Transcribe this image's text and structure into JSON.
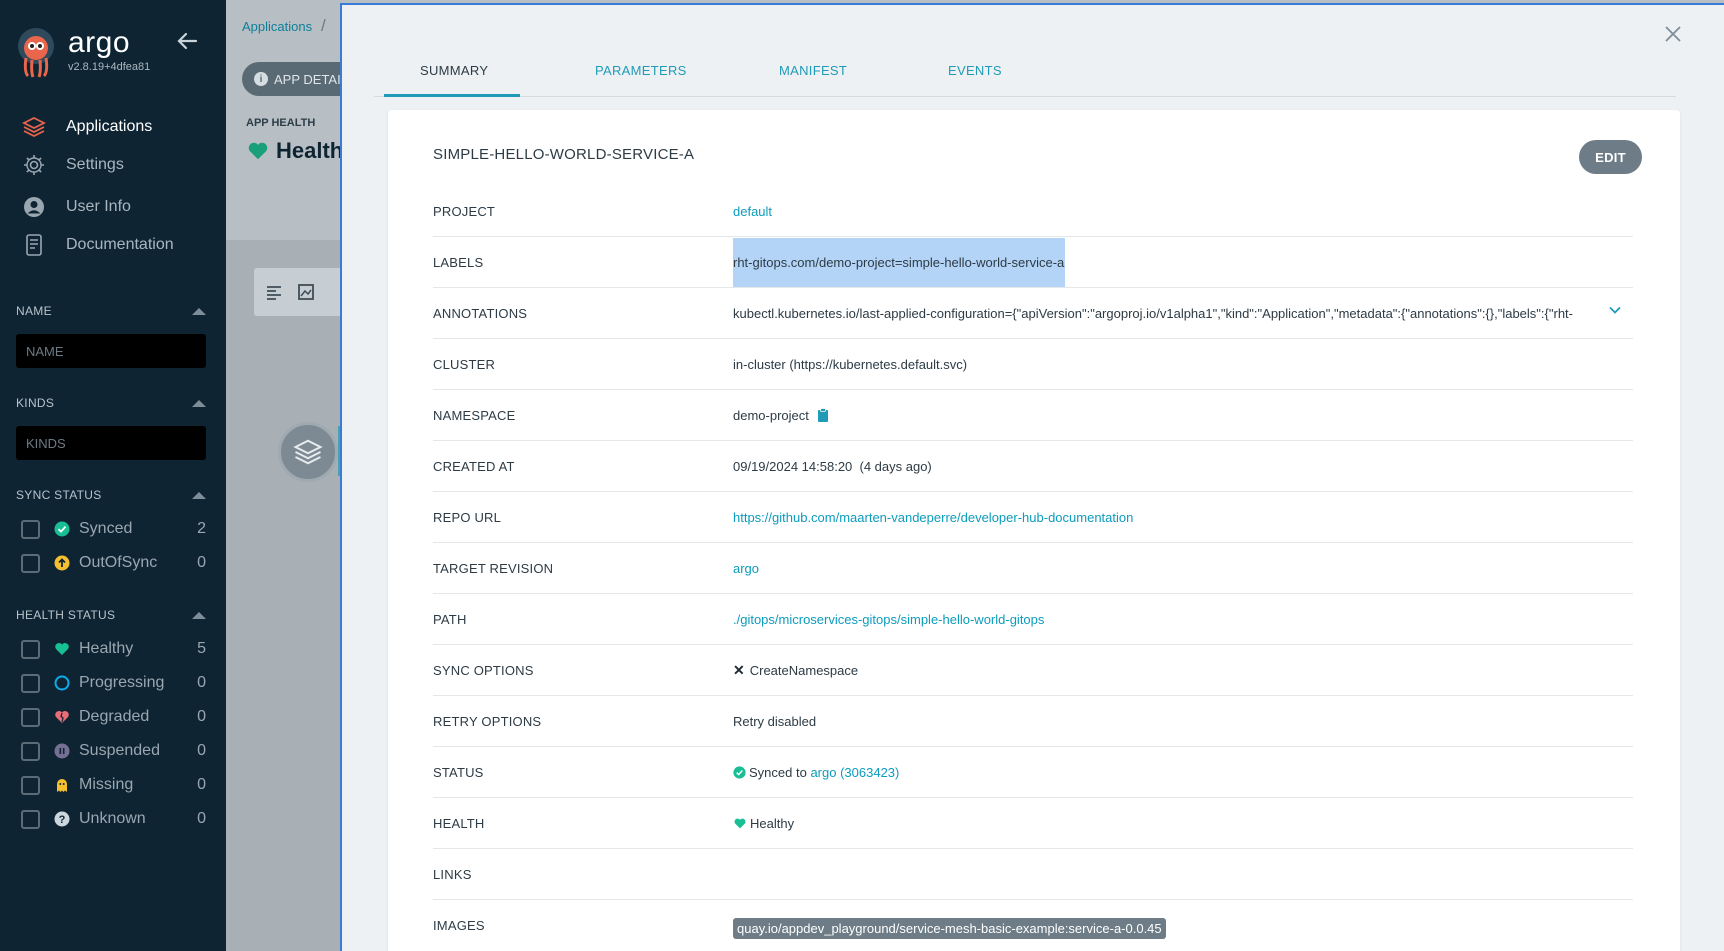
{
  "sidebar": {
    "brand": {
      "name": "argo",
      "version": "v2.8.19+4dfea81"
    },
    "nav": [
      {
        "label": "Applications",
        "icon": "stack-icon"
      },
      {
        "label": "Settings",
        "icon": "gear-icon"
      },
      {
        "label": "User Info",
        "icon": "user-icon"
      },
      {
        "label": "Documentation",
        "icon": "document-icon"
      }
    ],
    "filters": {
      "name": {
        "title": "NAME",
        "placeholder": "NAME"
      },
      "kinds": {
        "title": "KINDS",
        "placeholder": "KINDS"
      },
      "sync_status": {
        "title": "SYNC STATUS",
        "items": [
          {
            "label": "Synced",
            "count": "2",
            "color": "#18be94"
          },
          {
            "label": "OutOfSync",
            "count": "0",
            "color": "#f4c030"
          }
        ]
      },
      "health_status": {
        "title": "HEALTH STATUS",
        "items": [
          {
            "label": "Healthy",
            "count": "5",
            "color": "#18be94"
          },
          {
            "label": "Progressing",
            "count": "0",
            "color": "#0dadea"
          },
          {
            "label": "Degraded",
            "count": "0",
            "color": "#e96d76"
          },
          {
            "label": "Suspended",
            "count": "0",
            "color": "#766f94"
          },
          {
            "label": "Missing",
            "count": "0",
            "color": "#f4c030"
          },
          {
            "label": "Unknown",
            "count": "0",
            "color": "#ccd6dd"
          }
        ]
      }
    }
  },
  "background": {
    "breadcrumb": "Applications",
    "app_details_button": "APP DETAIL",
    "app_health_label": "APP HEALTH",
    "app_health_value": "Health"
  },
  "panel": {
    "tabs": [
      "SUMMARY",
      "PARAMETERS",
      "MANIFEST",
      "EVENTS"
    ],
    "active_tab": "SUMMARY",
    "title": "SIMPLE-HELLO-WORLD-SERVICE-A",
    "edit_label": "EDIT",
    "rows": {
      "project": {
        "key": "PROJECT",
        "value": "default"
      },
      "labels": {
        "key": "LABELS",
        "value": "rht-gitops.com/demo-project=simple-hello-world-service-a"
      },
      "annotations": {
        "key": "ANNOTATIONS",
        "value": "kubectl.kubernetes.io/last-applied-configuration={\"apiVersion\":\"argoproj.io/v1alpha1\",\"kind\":\"Application\",\"metadata\":{\"annotations\":{},\"labels\":{\"rht-"
      },
      "cluster": {
        "key": "CLUSTER",
        "value": "in-cluster (https://kubernetes.default.svc)"
      },
      "namespace": {
        "key": "NAMESPACE",
        "value": "demo-project"
      },
      "created_at": {
        "key": "CREATED AT",
        "value": "09/19/2024 14:58:20  (4 days ago)"
      },
      "repo_url": {
        "key": "REPO URL",
        "value": "https://github.com/maarten-vandeperre/developer-hub-documentation"
      },
      "target_revision": {
        "key": "TARGET REVISION",
        "value": "argo"
      },
      "path": {
        "key": "PATH",
        "value": "./gitops/microservices-gitops/simple-hello-world-gitops"
      },
      "sync_options": {
        "key": "SYNC OPTIONS",
        "value": "CreateNamespace"
      },
      "retry_options": {
        "key": "RETRY OPTIONS",
        "value": "Retry disabled"
      },
      "status": {
        "key": "STATUS",
        "prefix": "Synced to",
        "revision": "argo (3063423)"
      },
      "health": {
        "key": "HEALTH",
        "value": "Healthy"
      },
      "links": {
        "key": "LINKS",
        "value": ""
      },
      "images": {
        "key": "IMAGES",
        "value": "quay.io/appdev_playground/service-mesh-basic-example:service-a-0.0.45"
      }
    }
  }
}
